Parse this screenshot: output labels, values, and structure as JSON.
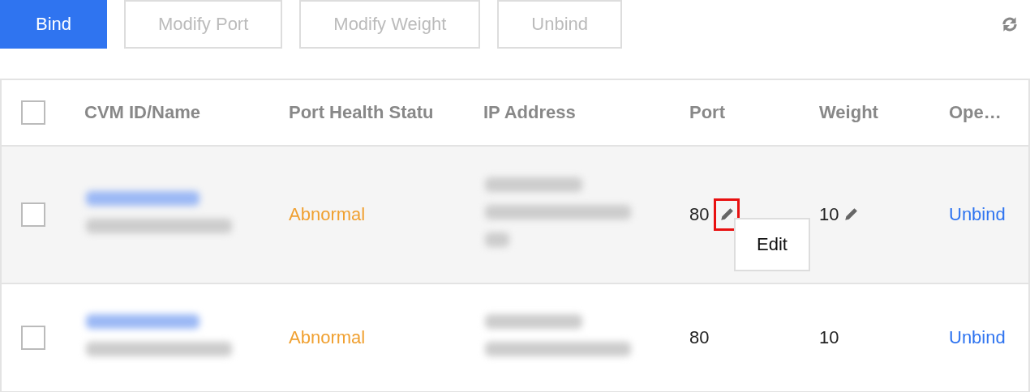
{
  "toolbar": {
    "buttons": [
      {
        "label": "Bind",
        "kind": "primary",
        "disabled": false
      },
      {
        "label": "Modify Port",
        "kind": "default",
        "disabled": true
      },
      {
        "label": "Modify Weight",
        "kind": "default",
        "disabled": true
      },
      {
        "label": "Unbind",
        "kind": "default",
        "disabled": true
      }
    ]
  },
  "table": {
    "select_all_checked": false,
    "columns": [
      "CVM ID/Name",
      "Port Health Statu",
      "IP Address",
      "Port",
      "Weight",
      "Ope…"
    ],
    "rows": [
      {
        "checked": false,
        "hovered": true,
        "health": "Abnormal",
        "port": "80",
        "weight": "10",
        "action": "Unbind",
        "port_edit_highlighted": true,
        "tooltip": "Edit"
      },
      {
        "checked": false,
        "hovered": false,
        "health": "Abnormal",
        "port": "80",
        "weight": "10",
        "action": "Unbind",
        "port_edit_highlighted": false
      }
    ]
  }
}
